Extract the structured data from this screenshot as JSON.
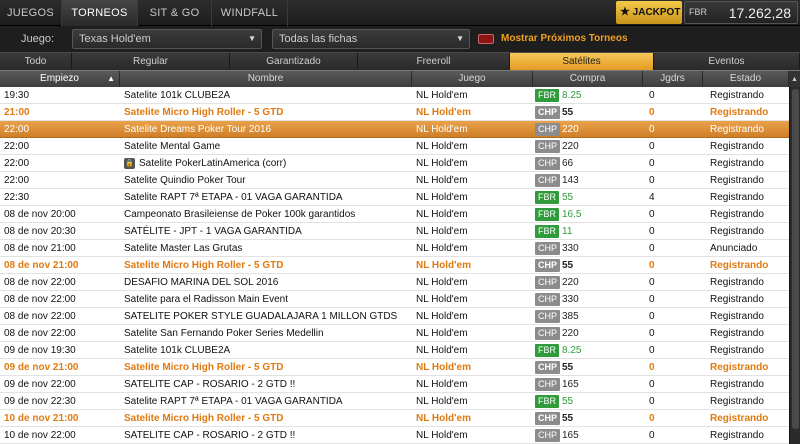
{
  "nav": {
    "tabs": [
      {
        "label": "JUEGOS"
      },
      {
        "label": "TORNEOS"
      },
      {
        "label": "SIT & GO"
      },
      {
        "label": "WINDFALL"
      }
    ],
    "jackpot_label": "JACKPOT",
    "currency": "FBR",
    "balance": "17.262,28"
  },
  "filters": {
    "game_label": "Juego:",
    "game_value": "Texas Hold'em",
    "chips_value": "Todas las fichas",
    "show_upcoming_label": "Mostrar Próximos Torneos"
  },
  "categories": [
    {
      "label": "Todo"
    },
    {
      "label": "Regular"
    },
    {
      "label": "Garantizado"
    },
    {
      "label": "Freeroll"
    },
    {
      "label": "Satélites"
    },
    {
      "label": "Eventos"
    }
  ],
  "columns": {
    "start": "Empiezo",
    "name": "Nombre",
    "game": "Juego",
    "buyin": "Compra",
    "players": "Jgdrs",
    "status": "Estado"
  },
  "colors": {
    "accent": "#e59b22",
    "highlight_text": "#e07a10",
    "fbr_badge": "#2f9b3b",
    "chp_badge": "#8c8c8c"
  },
  "rows": [
    {
      "time": "19:30",
      "name": "Satelite 101k CLUBE2A",
      "game": "NL Hold'em",
      "cur": "FBR",
      "amount": "8.25",
      "players": "0",
      "status": "Registrando",
      "style": ""
    },
    {
      "time": "21:00",
      "name": "Satelite Micro High Roller - 5 GTD",
      "game": "NL Hold'em",
      "cur": "CHP",
      "amount": "55",
      "players": "0",
      "status": "Registrando",
      "style": "highlight"
    },
    {
      "time": "22:00",
      "name": "Satelite Dreams Poker Tour 2016",
      "game": "NL Hold'em",
      "cur": "CHP",
      "amount": "220",
      "players": "0",
      "status": "Registrando",
      "style": "selected"
    },
    {
      "time": "22:00",
      "name": "Satelite Mental Game",
      "game": "NL Hold'em",
      "cur": "CHP",
      "amount": "220",
      "players": "0",
      "status": "Registrando",
      "style": ""
    },
    {
      "time": "22:00",
      "name": "Satelite PokerLatinAmerica (corr)",
      "game": "NL Hold'em",
      "cur": "CHP",
      "amount": "66",
      "players": "0",
      "status": "Registrando",
      "style": "",
      "locked": true
    },
    {
      "time": "22:00",
      "name": "Satelite Quindio Poker Tour",
      "game": "NL Hold'em",
      "cur": "CHP",
      "amount": "143",
      "players": "0",
      "status": "Registrando",
      "style": ""
    },
    {
      "time": "22:30",
      "name": "Satelite RAPT 7ª ETAPA - 01 VAGA GARANTIDA",
      "game": "NL Hold'em",
      "cur": "FBR",
      "amount": "55",
      "players": "4",
      "status": "Registrando",
      "style": ""
    },
    {
      "time": "08 de nov 20:00",
      "name": "Campeonato Brasileiense de Poker 100k garantidos",
      "game": "NL Hold'em",
      "cur": "FBR",
      "amount": "16.5",
      "players": "0",
      "status": "Registrando",
      "style": ""
    },
    {
      "time": "08 de nov 20:30",
      "name": "SATÉLITE - JPT - 1 VAGA GARANTIDA",
      "game": "NL Hold'em",
      "cur": "FBR",
      "amount": "11",
      "players": "0",
      "status": "Registrando",
      "style": ""
    },
    {
      "time": "08 de nov 21:00",
      "name": "Satelite Master Las Grutas",
      "game": "NL Hold'em",
      "cur": "CHP",
      "amount": "330",
      "players": "0",
      "status": "Anunciado",
      "style": ""
    },
    {
      "time": "08 de nov 21:00",
      "name": "Satelite Micro High Roller - 5 GTD",
      "game": "NL Hold'em",
      "cur": "CHP",
      "amount": "55",
      "players": "0",
      "status": "Registrando",
      "style": "highlight"
    },
    {
      "time": "08 de nov 22:00",
      "name": "DESAFIO MARINA DEL SOL 2016",
      "game": "NL Hold'em",
      "cur": "CHP",
      "amount": "220",
      "players": "0",
      "status": "Registrando",
      "style": ""
    },
    {
      "time": "08 de nov 22:00",
      "name": "Satelite para el Radisson Main Event",
      "game": "NL Hold'em",
      "cur": "CHP",
      "amount": "330",
      "players": "0",
      "status": "Registrando",
      "style": ""
    },
    {
      "time": "08 de nov 22:00",
      "name": "SATELITE POKER STYLE GUADALAJARA 1 MILLON GTDS",
      "game": "NL Hold'em",
      "cur": "CHP",
      "amount": "385",
      "players": "0",
      "status": "Registrando",
      "style": ""
    },
    {
      "time": "08 de nov 22:00",
      "name": "Satelite San Fernando Poker Series Medellin",
      "game": "NL Hold'em",
      "cur": "CHP",
      "amount": "220",
      "players": "0",
      "status": "Registrando",
      "style": ""
    },
    {
      "time": "09 de nov 19:30",
      "name": "Satelite 101k CLUBE2A",
      "game": "NL Hold'em",
      "cur": "FBR",
      "amount": "8.25",
      "players": "0",
      "status": "Registrando",
      "style": ""
    },
    {
      "time": "09 de nov 21:00",
      "name": "Satelite Micro High Roller - 5 GTD",
      "game": "NL Hold'em",
      "cur": "CHP",
      "amount": "55",
      "players": "0",
      "status": "Registrando",
      "style": "highlight"
    },
    {
      "time": "09 de nov 22:00",
      "name": "SATELITE CAP - ROSARIO - 2 GTD !!",
      "game": "NL Hold'em",
      "cur": "CHP",
      "amount": "165",
      "players": "0",
      "status": "Registrando",
      "style": ""
    },
    {
      "time": "09 de nov 22:30",
      "name": "Satelite RAPT 7ª ETAPA - 01 VAGA GARANTIDA",
      "game": "NL Hold'em",
      "cur": "FBR",
      "amount": "55",
      "players": "0",
      "status": "Registrando",
      "style": ""
    },
    {
      "time": "10 de nov 21:00",
      "name": "Satelite Micro High Roller - 5 GTD",
      "game": "NL Hold'em",
      "cur": "CHP",
      "amount": "55",
      "players": "0",
      "status": "Registrando",
      "style": "highlight"
    },
    {
      "time": "10 de nov 22:00",
      "name": "SATELITE CAP - ROSARIO - 2 GTD !!",
      "game": "NL Hold'em",
      "cur": "CHP",
      "amount": "165",
      "players": "0",
      "status": "Registrando",
      "style": ""
    }
  ]
}
